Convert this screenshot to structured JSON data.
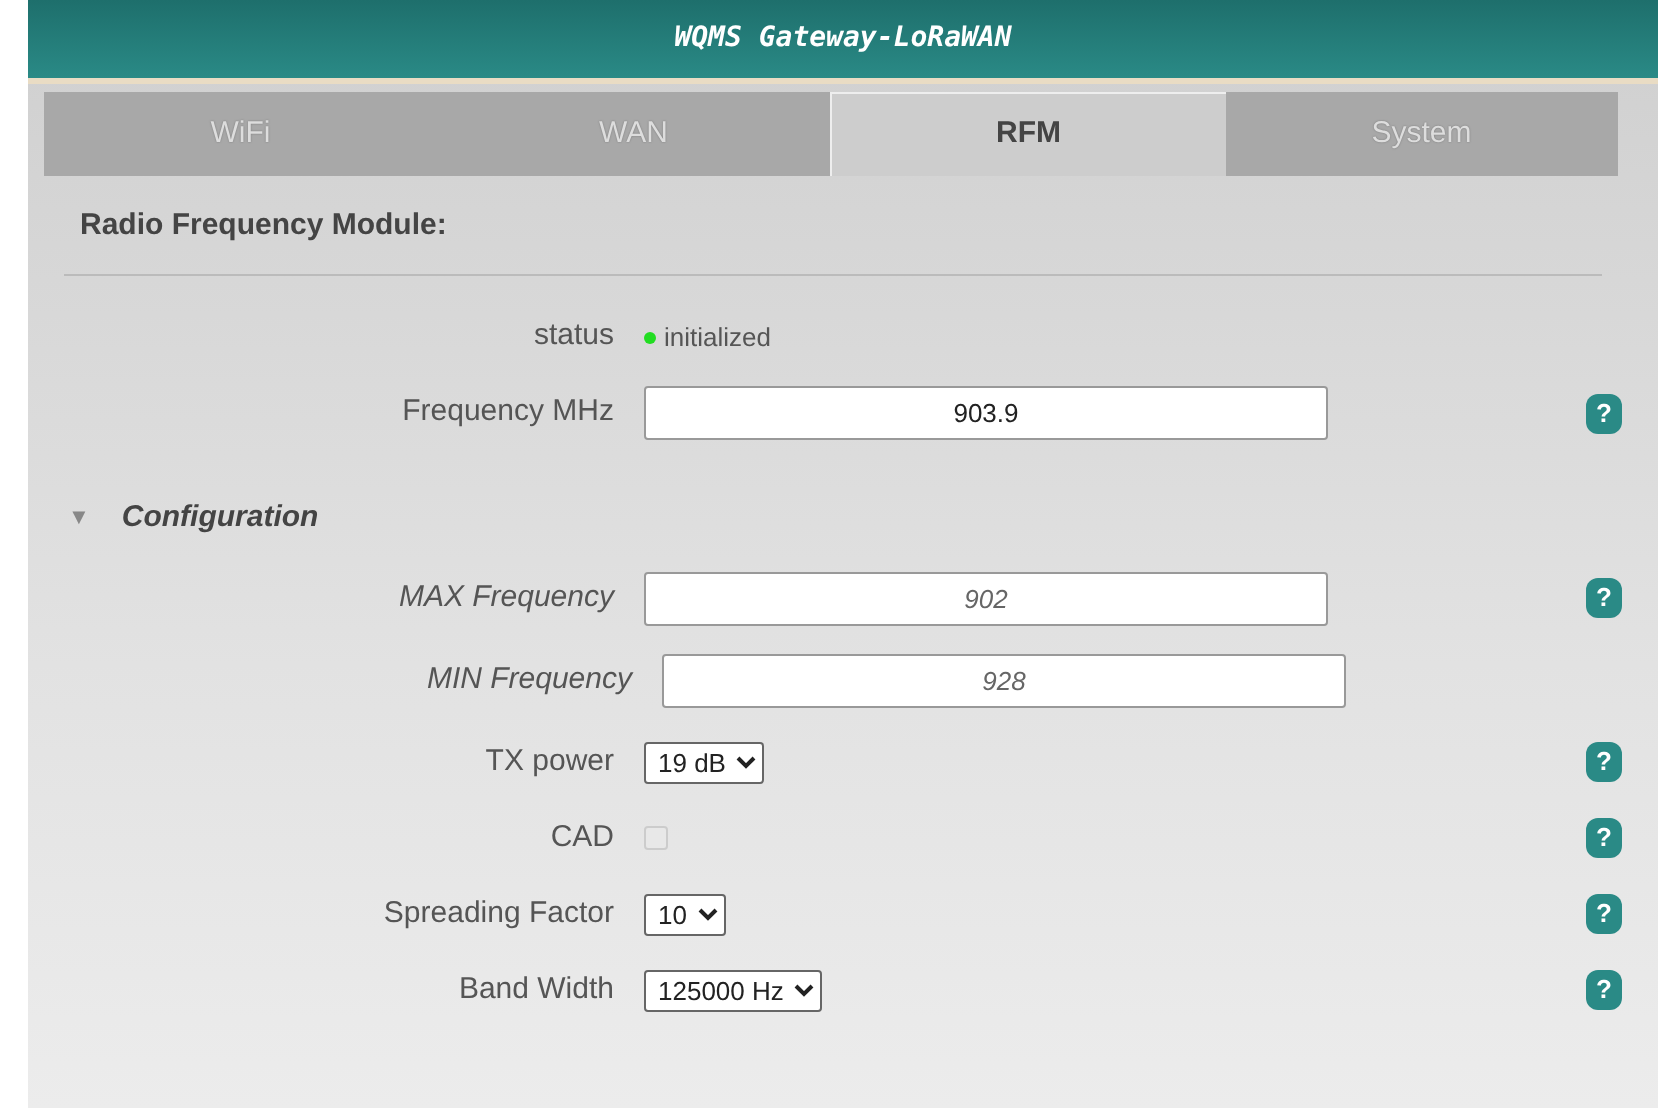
{
  "header": {
    "title": "WQMS Gateway-LoRaWAN"
  },
  "tabs": [
    {
      "label": "WiFi",
      "selected": false
    },
    {
      "label": "WAN",
      "selected": false
    },
    {
      "label": "RFM",
      "selected": true
    },
    {
      "label": "System",
      "selected": false
    }
  ],
  "section": {
    "title": "Radio Frequency Module:"
  },
  "status": {
    "label": "status",
    "value": "initialized",
    "color": "#22dd22"
  },
  "main_fields": [
    {
      "kind": "input",
      "label": "Frequency MHz",
      "value": "903.9",
      "italic": false,
      "help": true
    }
  ],
  "configuration": {
    "title": "Configuration",
    "expanded": true,
    "toggle": "▼",
    "fields": [
      {
        "kind": "input",
        "label": "MAX Frequency",
        "value": "902",
        "italic": true,
        "help": true
      },
      {
        "kind": "input",
        "label": "MIN Frequency",
        "value": "928",
        "italic": true,
        "help": false
      },
      {
        "kind": "select",
        "label": "TX power",
        "value": "19 dB",
        "help": true
      },
      {
        "kind": "checkbox",
        "label": "CAD",
        "checked": false,
        "disabled": true,
        "help": true
      },
      {
        "kind": "select",
        "label": "Spreading Factor",
        "value": "10",
        "help": true
      },
      {
        "kind": "select",
        "label": "Band Width",
        "value": "125000 Hz",
        "help": true
      }
    ]
  },
  "help_glyph": "?"
}
